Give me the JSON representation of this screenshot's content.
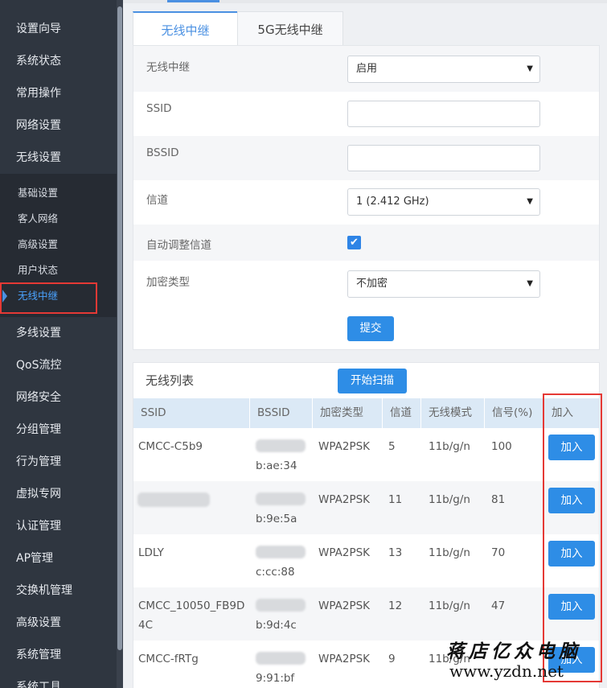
{
  "sidebar": {
    "items_top": [
      "设置向导",
      "系统状态",
      "常用操作",
      "网络设置",
      "无线设置"
    ],
    "sub_items": [
      "基础设置",
      "客人网络",
      "高级设置",
      "用户状态",
      "无线中继"
    ],
    "items_bottom": [
      "多线设置",
      "QoS流控",
      "网络安全",
      "分组管理",
      "行为管理",
      "虚拟专网",
      "认证管理",
      "AP管理",
      "交换机管理",
      "高级设置",
      "系统管理",
      "系统工具"
    ]
  },
  "tabs": [
    "无线中继",
    "5G无线中继"
  ],
  "form": {
    "repeater_label": "无线中继",
    "repeater_value": "启用",
    "ssid_label": "SSID",
    "ssid_value": "",
    "bssid_label": "BSSID",
    "bssid_value": "",
    "channel_label": "信道",
    "channel_value": "1 (2.412 GHz)",
    "auto_channel_label": "自动调整信道",
    "auto_channel_checked": true,
    "encryption_label": "加密类型",
    "encryption_value": "不加密",
    "submit_label": "提交"
  },
  "wireless_list": {
    "title": "无线列表",
    "scan_label": "开始扫描",
    "columns": [
      "SSID",
      "BSSID",
      "加密类型",
      "信道",
      "无线模式",
      "信号(%)",
      "加入"
    ],
    "join_label": "加入",
    "rows": [
      {
        "ssid": "CMCC-C5b9",
        "bssid_tail": "b:ae:34",
        "encryption": "WPA2PSK",
        "channel": "5",
        "mode": "11b/g/n",
        "signal": "100"
      },
      {
        "ssid": "",
        "bssid_tail": "b:9e:5a",
        "encryption": "WPA2PSK",
        "channel": "11",
        "mode": "11b/g/n",
        "signal": "81"
      },
      {
        "ssid": "LDLY",
        "bssid_tail": "c:cc:88",
        "encryption": "WPA2PSK",
        "channel": "13",
        "mode": "11b/g/n",
        "signal": "70"
      },
      {
        "ssid": "CMCC_10050_FB9D",
        "ssid_line2": "4C",
        "bssid_tail": "b:9d:4c",
        "encryption": "WPA2PSK",
        "channel": "12",
        "mode": "11b/g/n",
        "signal": "47"
      },
      {
        "ssid": "CMCC-fRTg",
        "bssid_tail": "9:91:bf",
        "encryption": "WPA2PSK",
        "channel": "9",
        "mode": "11b/g/n",
        "signal": ""
      }
    ]
  },
  "watermark": {
    "title": "蒋店亿众电脑",
    "url": "www.yzdn.net"
  },
  "colors": {
    "sidebar_bg": "#2f3640",
    "accent": "#2e8de6",
    "highlight": "#e53935"
  }
}
